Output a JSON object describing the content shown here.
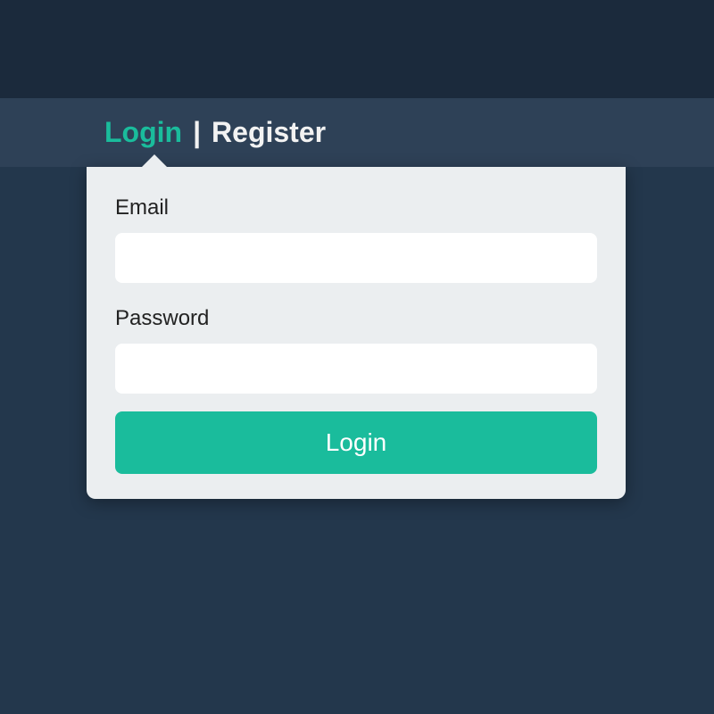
{
  "tabs": {
    "login_label": "Login",
    "separator": "|",
    "register_label": "Register"
  },
  "form": {
    "email_label": "Email",
    "email_value": "",
    "password_label": "Password",
    "password_value": "",
    "submit_label": "Login"
  },
  "colors": {
    "accent": "#1abc9c",
    "panel": "#ebeef0",
    "bg_dark": "#23374c",
    "bg_header": "#2e4157",
    "bg_banner": "#1b2a3c"
  }
}
